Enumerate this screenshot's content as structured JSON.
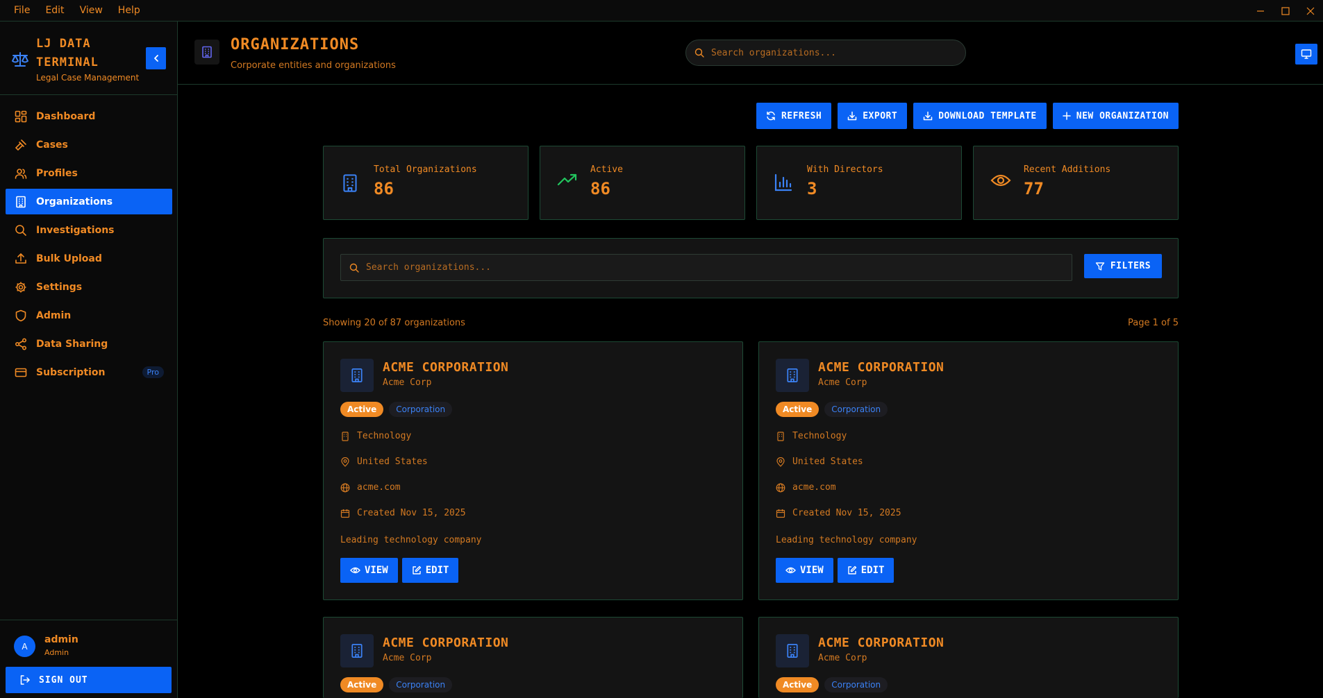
{
  "menubar": {
    "items": [
      "File",
      "Edit",
      "View",
      "Help"
    ]
  },
  "sidebar": {
    "brand_line1": "LJ DATA",
    "brand_line2": "TERMINAL",
    "brand_sub": "Legal Case Management",
    "items": [
      {
        "label": "Dashboard",
        "icon": "dashboard-icon"
      },
      {
        "label": "Cases",
        "icon": "gavel-icon"
      },
      {
        "label": "Profiles",
        "icon": "users-icon"
      },
      {
        "label": "Organizations",
        "icon": "building-icon"
      },
      {
        "label": "Investigations",
        "icon": "search-icon"
      },
      {
        "label": "Bulk Upload",
        "icon": "upload-icon"
      },
      {
        "label": "Settings",
        "icon": "gear-icon"
      },
      {
        "label": "Admin",
        "icon": "shield-icon"
      },
      {
        "label": "Data Sharing",
        "icon": "share-icon"
      },
      {
        "label": "Subscription",
        "icon": "credit-card-icon"
      }
    ],
    "subscription_badge": "Pro",
    "user": {
      "initial": "A",
      "name": "admin",
      "role": "Admin"
    },
    "signout_label": "SIGN OUT"
  },
  "header": {
    "title": "ORGANIZATIONS",
    "subtitle": "Corporate entities and organizations",
    "search_placeholder": "Search organizations..."
  },
  "actions": {
    "refresh": "REFRESH",
    "export": "EXPORT",
    "download_template": "DOWNLOAD TEMPLATE",
    "new_org": "NEW ORGANIZATION"
  },
  "stats": [
    {
      "label": "Total Organizations",
      "value": "86",
      "icon": "building-icon",
      "color": "#3b82f6"
    },
    {
      "label": "Active",
      "value": "86",
      "icon": "trending-up-icon",
      "color": "#22c55e"
    },
    {
      "label": "With Directors",
      "value": "3",
      "icon": "bar-chart-icon",
      "color": "#3b82f6"
    },
    {
      "label": "Recent Additions",
      "value": "77",
      "icon": "eye-icon",
      "color": "#f08a24"
    }
  ],
  "filter": {
    "search_placeholder": "Search organizations...",
    "filters_label": "FILTERS"
  },
  "list": {
    "showing": "Showing 20 of 87 organizations",
    "page": "Page 1 of 5"
  },
  "cards": [
    {
      "name": "ACME CORPORATION",
      "alias": "Acme Corp",
      "status": "Active",
      "type": "Corporation",
      "industry": "Technology",
      "country": "United States",
      "website": "acme.com",
      "created": "Created Nov 15, 2025",
      "description": "Leading technology company",
      "view": "VIEW",
      "edit": "EDIT"
    },
    {
      "name": "ACME CORPORATION",
      "alias": "Acme Corp",
      "status": "Active",
      "type": "Corporation",
      "industry": "Technology",
      "country": "United States",
      "website": "acme.com",
      "created": "Created Nov 15, 2025",
      "description": "Leading technology company",
      "view": "VIEW",
      "edit": "EDIT"
    },
    {
      "name": "ACME CORPORATION",
      "alias": "Acme Corp",
      "status": "Active",
      "type": "Corporation"
    },
    {
      "name": "ACME CORPORATION",
      "alias": "Acme Corp",
      "status": "Active",
      "type": "Corporation"
    }
  ],
  "colors": {
    "accent": "#f08a24",
    "primary": "#0a63f5",
    "border": "#1d4a35",
    "background": "#000000"
  }
}
